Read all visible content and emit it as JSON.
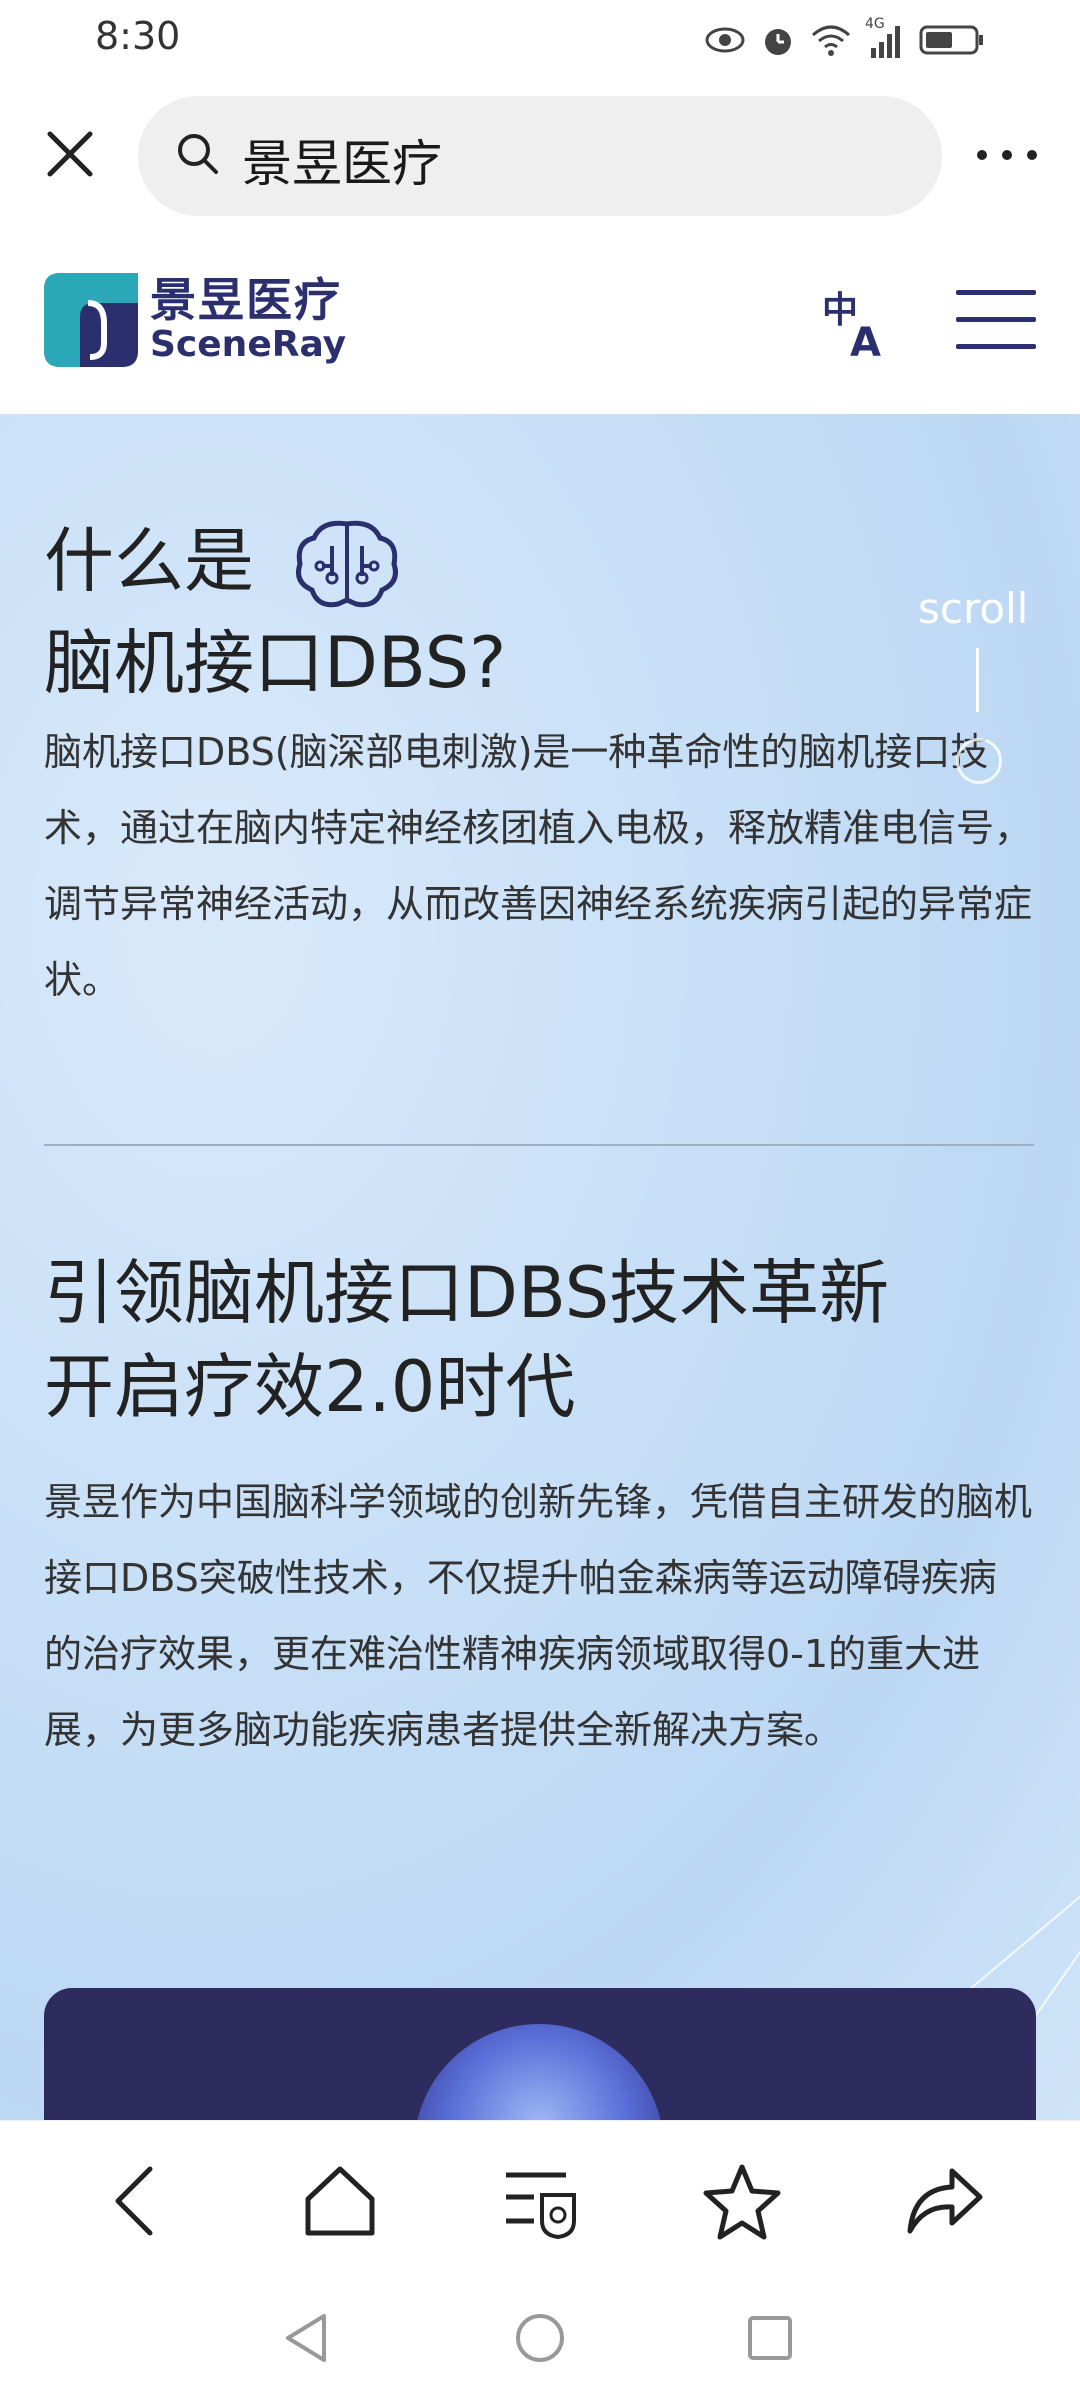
{
  "status_bar": {
    "time": "8:30",
    "icons": [
      "eye-icon",
      "alarm-icon",
      "wifi-icon",
      "signal-icon",
      "battery-icon"
    ],
    "network": "4G"
  },
  "browser": {
    "search_text": "景昱医疗"
  },
  "site": {
    "logo_cn": "景昱医疗",
    "logo_en": "SceneRay",
    "brand_color": "#2b2f6e",
    "accent_color": "#2aa8b8"
  },
  "section1": {
    "title_line1": "什么是",
    "title_line2": "脑机接口DBS?",
    "body": "脑机接口DBS(脑深部电刺激)是一种革命性的脑机接口技术，通过在脑内特定神经核团植入电极，释放精准电信号，调节异常神经活动，从而改善因神经系统疾病引起的异常症状。"
  },
  "scroll_hint": "scroll",
  "section2": {
    "title_line1": "引领脑机接口DBS技术革新",
    "title_line2": "开启疗效2.0时代",
    "body": "景昱作为中国脑科学领域的创新先锋，凭借自主研发的脑机接口DBS突破性技术，不仅提升帕金森病等运动障碍疾病的治疗效果，更在难治性精神疾病领域取得0-1的重大进展，为更多脑功能疾病患者提供全新解决方案。"
  },
  "bottom_nav": [
    "back-icon",
    "home-icon",
    "tabs-icon",
    "bookmark-icon",
    "share-icon"
  ],
  "system_nav": [
    "system-back-icon",
    "system-home-icon",
    "system-recents-icon"
  ]
}
